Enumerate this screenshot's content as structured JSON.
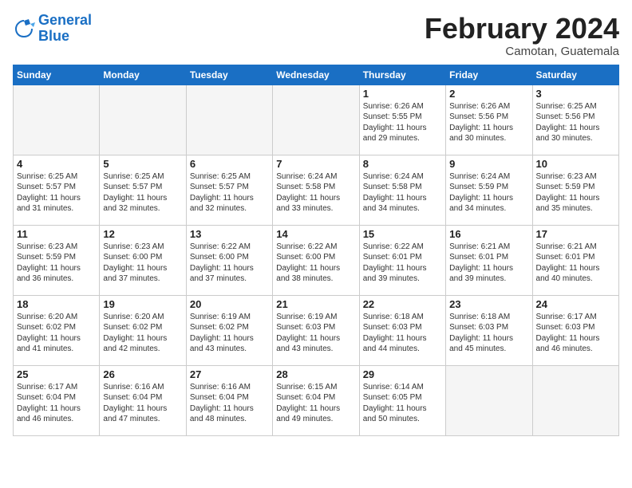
{
  "logo": {
    "line1": "General",
    "line2": "Blue"
  },
  "title": "February 2024",
  "location": "Camotan, Guatemala",
  "days_of_week": [
    "Sunday",
    "Monday",
    "Tuesday",
    "Wednesday",
    "Thursday",
    "Friday",
    "Saturday"
  ],
  "weeks": [
    [
      {
        "day": "",
        "content": ""
      },
      {
        "day": "",
        "content": ""
      },
      {
        "day": "",
        "content": ""
      },
      {
        "day": "",
        "content": ""
      },
      {
        "day": "1",
        "content": "Sunrise: 6:26 AM\nSunset: 5:55 PM\nDaylight: 11 hours\nand 29 minutes."
      },
      {
        "day": "2",
        "content": "Sunrise: 6:26 AM\nSunset: 5:56 PM\nDaylight: 11 hours\nand 30 minutes."
      },
      {
        "day": "3",
        "content": "Sunrise: 6:25 AM\nSunset: 5:56 PM\nDaylight: 11 hours\nand 30 minutes."
      }
    ],
    [
      {
        "day": "4",
        "content": "Sunrise: 6:25 AM\nSunset: 5:57 PM\nDaylight: 11 hours\nand 31 minutes."
      },
      {
        "day": "5",
        "content": "Sunrise: 6:25 AM\nSunset: 5:57 PM\nDaylight: 11 hours\nand 32 minutes."
      },
      {
        "day": "6",
        "content": "Sunrise: 6:25 AM\nSunset: 5:57 PM\nDaylight: 11 hours\nand 32 minutes."
      },
      {
        "day": "7",
        "content": "Sunrise: 6:24 AM\nSunset: 5:58 PM\nDaylight: 11 hours\nand 33 minutes."
      },
      {
        "day": "8",
        "content": "Sunrise: 6:24 AM\nSunset: 5:58 PM\nDaylight: 11 hours\nand 34 minutes."
      },
      {
        "day": "9",
        "content": "Sunrise: 6:24 AM\nSunset: 5:59 PM\nDaylight: 11 hours\nand 34 minutes."
      },
      {
        "day": "10",
        "content": "Sunrise: 6:23 AM\nSunset: 5:59 PM\nDaylight: 11 hours\nand 35 minutes."
      }
    ],
    [
      {
        "day": "11",
        "content": "Sunrise: 6:23 AM\nSunset: 5:59 PM\nDaylight: 11 hours\nand 36 minutes."
      },
      {
        "day": "12",
        "content": "Sunrise: 6:23 AM\nSunset: 6:00 PM\nDaylight: 11 hours\nand 37 minutes."
      },
      {
        "day": "13",
        "content": "Sunrise: 6:22 AM\nSunset: 6:00 PM\nDaylight: 11 hours\nand 37 minutes."
      },
      {
        "day": "14",
        "content": "Sunrise: 6:22 AM\nSunset: 6:00 PM\nDaylight: 11 hours\nand 38 minutes."
      },
      {
        "day": "15",
        "content": "Sunrise: 6:22 AM\nSunset: 6:01 PM\nDaylight: 11 hours\nand 39 minutes."
      },
      {
        "day": "16",
        "content": "Sunrise: 6:21 AM\nSunset: 6:01 PM\nDaylight: 11 hours\nand 39 minutes."
      },
      {
        "day": "17",
        "content": "Sunrise: 6:21 AM\nSunset: 6:01 PM\nDaylight: 11 hours\nand 40 minutes."
      }
    ],
    [
      {
        "day": "18",
        "content": "Sunrise: 6:20 AM\nSunset: 6:02 PM\nDaylight: 11 hours\nand 41 minutes."
      },
      {
        "day": "19",
        "content": "Sunrise: 6:20 AM\nSunset: 6:02 PM\nDaylight: 11 hours\nand 42 minutes."
      },
      {
        "day": "20",
        "content": "Sunrise: 6:19 AM\nSunset: 6:02 PM\nDaylight: 11 hours\nand 43 minutes."
      },
      {
        "day": "21",
        "content": "Sunrise: 6:19 AM\nSunset: 6:03 PM\nDaylight: 11 hours\nand 43 minutes."
      },
      {
        "day": "22",
        "content": "Sunrise: 6:18 AM\nSunset: 6:03 PM\nDaylight: 11 hours\nand 44 minutes."
      },
      {
        "day": "23",
        "content": "Sunrise: 6:18 AM\nSunset: 6:03 PM\nDaylight: 11 hours\nand 45 minutes."
      },
      {
        "day": "24",
        "content": "Sunrise: 6:17 AM\nSunset: 6:03 PM\nDaylight: 11 hours\nand 46 minutes."
      }
    ],
    [
      {
        "day": "25",
        "content": "Sunrise: 6:17 AM\nSunset: 6:04 PM\nDaylight: 11 hours\nand 46 minutes."
      },
      {
        "day": "26",
        "content": "Sunrise: 6:16 AM\nSunset: 6:04 PM\nDaylight: 11 hours\nand 47 minutes."
      },
      {
        "day": "27",
        "content": "Sunrise: 6:16 AM\nSunset: 6:04 PM\nDaylight: 11 hours\nand 48 minutes."
      },
      {
        "day": "28",
        "content": "Sunrise: 6:15 AM\nSunset: 6:04 PM\nDaylight: 11 hours\nand 49 minutes."
      },
      {
        "day": "29",
        "content": "Sunrise: 6:14 AM\nSunset: 6:05 PM\nDaylight: 11 hours\nand 50 minutes."
      },
      {
        "day": "",
        "content": ""
      },
      {
        "day": "",
        "content": ""
      }
    ]
  ]
}
